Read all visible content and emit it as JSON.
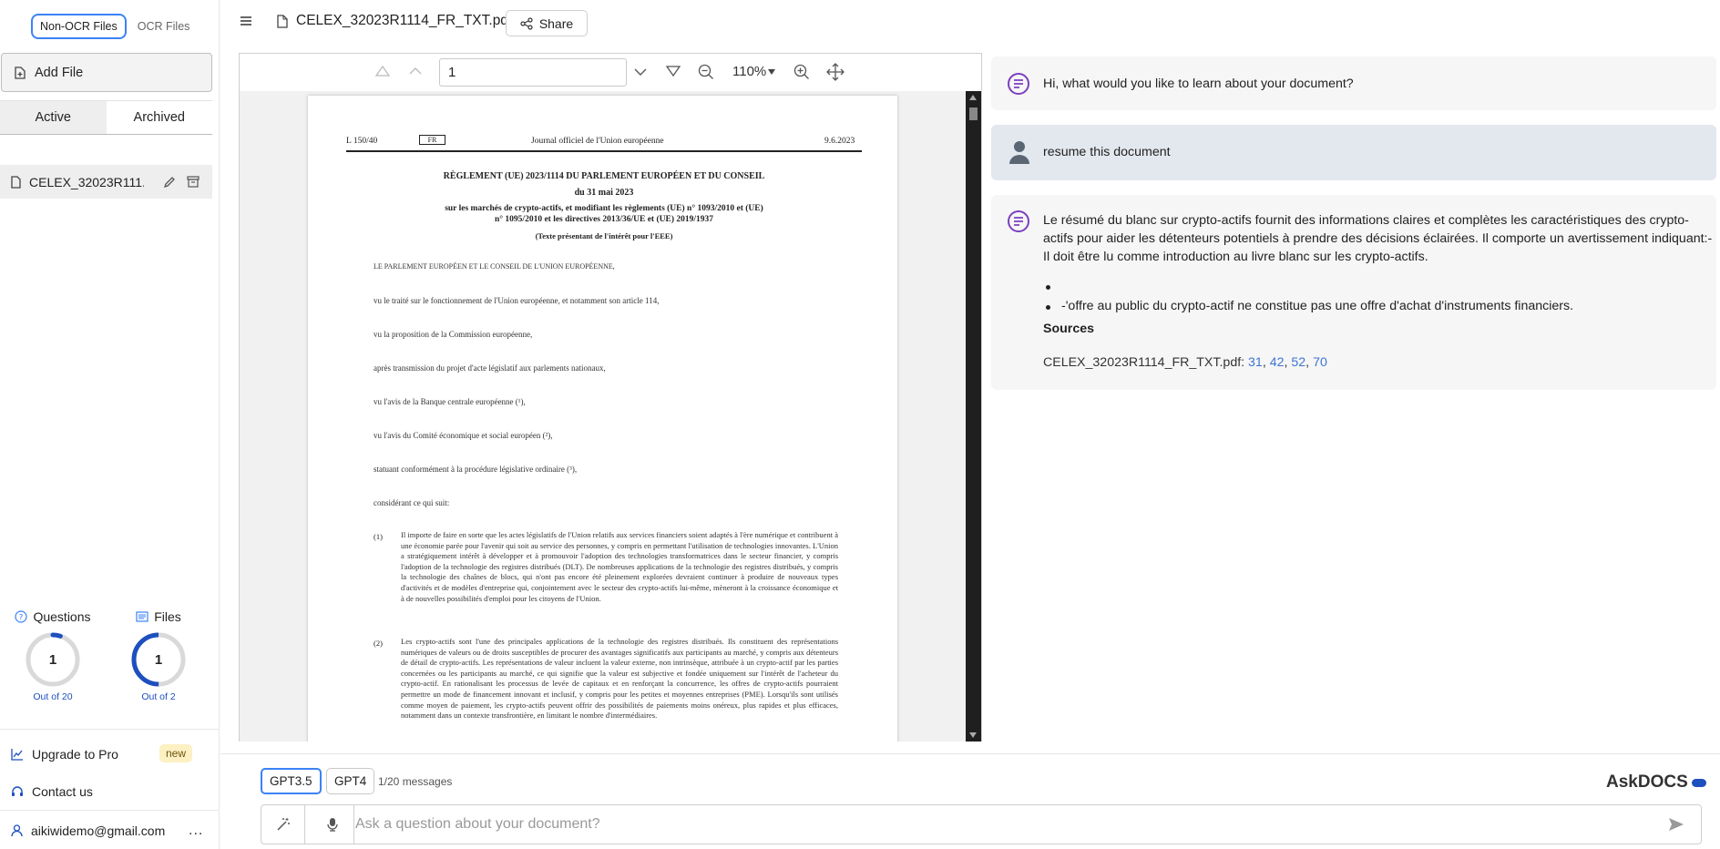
{
  "sidebar": {
    "toggle": {
      "non_ocr": "Non-OCR Files",
      "ocr": "OCR Files"
    },
    "add_file": "Add File",
    "tabs": {
      "active": "Active",
      "archived": "Archived"
    },
    "file_item": "CELEX_32023R111...",
    "stats": {
      "questions": {
        "label": "Questions",
        "value": "1",
        "sub": "Out of 20",
        "progress": 0.05
      },
      "files": {
        "label": "Files",
        "value": "1",
        "sub": "Out of 2",
        "progress": 0.5
      }
    },
    "upgrade": "Upgrade to Pro",
    "badge_new": "new",
    "contact": "Contact us",
    "user_email": "aikiwidemo@gmail.com",
    "more": "..."
  },
  "header": {
    "doc_title": "CELEX_32023R1114_FR_TXT.pdf",
    "share": "Share"
  },
  "viewer": {
    "page_value": "1",
    "zoom": "110%",
    "page": {
      "left_header": "L 150/40",
      "lang_box": "FR",
      "center_header": "Journal officiel de l'Union européenne",
      "date_header": "9.6.2023",
      "title1": "RÈGLEMENT (UE) 2023/1114 DU PARLEMENT EUROPÉEN ET DU CONSEIL",
      "title2": "du 31 mai 2023",
      "title3": "sur les marchés de crypto-actifs, et modifiant les règlements (UE) n° 1093/2010 et (UE)",
      "title4": "n° 1095/2010 et les directives 2013/36/UE et (UE) 2019/1937",
      "title5": "(Texte présentant de l'intérêt pour l'EEE)",
      "l1": "LE PARLEMENT EUROPÉEN ET LE CONSEIL DE L'UNION EUROPÉENNE,",
      "l2": "vu le traité sur le fonctionnement de l'Union européenne, et notamment son article 114,",
      "l3": "vu la proposition de la Commission européenne,",
      "l4": "après transmission du projet d'acte législatif aux parlements nationaux,",
      "l5": "vu l'avis de la Banque centrale européenne (¹),",
      "l6": "vu l'avis du Comité économique et social européen (²),",
      "l7": "statuant conformément à la procédure législative ordinaire (³),",
      "l8": "considérant ce qui suit:",
      "n1": "(1)",
      "p1": "Il importe de faire en sorte que les actes législatifs de l'Union relatifs aux services financiers soient adaptés à l'ère numérique et contribuent à une économie parée pour l'avenir qui soit au service des personnes, y compris en permettant l'utilisation de technologies innovantes. L'Union a stratégiquement intérêt à développer et à promouvoir l'adoption des technologies transformatrices dans le secteur financier, y compris l'adoption de la technologie des registres distribués (DLT). De nombreuses applications de la technologie des registres distribués, y compris la technologie des chaînes de blocs, qui n'ont pas encore été pleinement explorées devraient continuer à produire de nouveaux types d'activités et de modèles d'entreprise qui, conjointement avec le secteur des crypto-actifs lui-même, mèneront à la croissance économique et à de nouvelles possibilités d'emploi pour les citoyens de l'Union.",
      "n2": "(2)",
      "p2": "Les crypto-actifs sont l'une des principales applications de la technologie des registres distribués. Ils constituent des représentations numériques de valeurs ou de droits susceptibles de procurer des avantages significatifs aux participants au marché, y compris aux détenteurs de détail de crypto-actifs. Les représentations de valeur incluent la valeur externe, non intrinsèque, attribuée à un crypto-actif par les parties concernées ou les participants au marché, ce qui signifie que la valeur est subjective et fondée uniquement sur l'intérêt de l'acheteur du crypto-actif. En rationalisant les processus de levée de capitaux et en renforçant la concurrence, les offres de crypto-actifs pourraient permettre un mode de financement innovant et inclusif, y compris pour les petites et moyennes entreprises (PME). Lorsqu'ils sont utilisés comme moyen de paiement, les crypto-actifs peuvent offrir des possibilités de paiements moins onéreux, plus rapides et plus efficaces, notamment dans un contexte transfrontière, en limitant le nombre d'intermédiaires."
    }
  },
  "chat": {
    "m1": "Hi, what would you like to learn about your document?",
    "m2": "resume this document",
    "m3_line1": "Le résumé du blanc sur crypto-actifs fournit des informations claires et complètes les caractéristiques des crypto-",
    "m3_line2": "actifs pour aider les détenteurs potentiels à prendre des décisions éclairées. Il comporte un avertissement indiquant:-",
    "m3_line3": "Il doit être lu comme introduction au livre blanc sur les crypto-actifs.",
    "bullet1": "",
    "bullet2": "-'offre au public du crypto-actif ne constitue pas une offre d'achat d'instruments financiers.",
    "sources_heading": "Sources",
    "sources_file": "CELEX_32023R1114_FR_TXT.pdf:",
    "source_pages": [
      "31",
      "42",
      "52",
      "70"
    ]
  },
  "bottom": {
    "gpt35": "GPT3.5",
    "gpt4": "GPT4",
    "msg_count": "1/20 messages",
    "brand": "AskDOCS",
    "placeholder": "Ask a question about your document?"
  },
  "colors": {
    "accent": "#3b82f6",
    "brand": "#1d4fbf",
    "link": "#3d74d4"
  }
}
